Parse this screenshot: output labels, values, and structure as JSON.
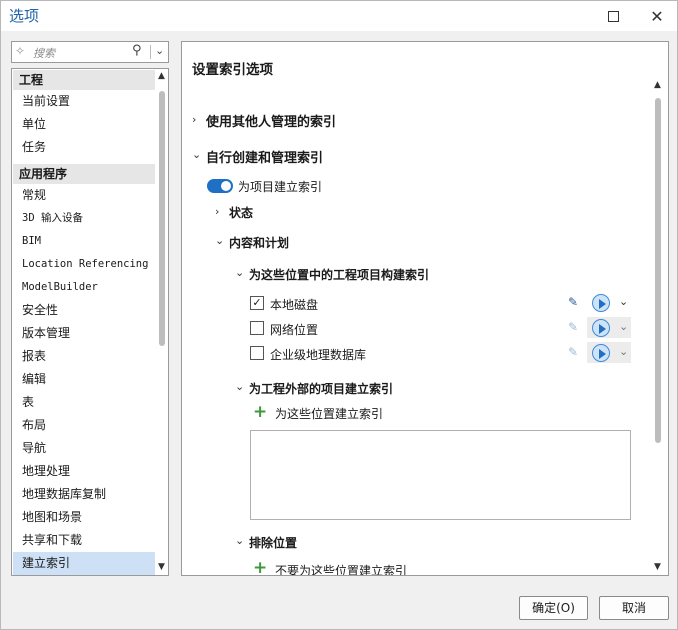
{
  "window": {
    "title": "选项"
  },
  "search": {
    "placeholder": "搜索"
  },
  "sidebar": {
    "groups": [
      {
        "label": "工程",
        "items": [
          "当前设置",
          "单位",
          "任务"
        ]
      },
      {
        "label": "应用程序",
        "items": [
          "常规",
          "3D 输入设备",
          "BIM",
          "Location Referencing",
          "ModelBuilder",
          "安全性",
          "版本管理",
          "报表",
          "编辑",
          "表",
          "布局",
          "导航",
          "地理处理",
          "地理数据库复制",
          "地图和场景",
          "共享和下载",
          "建立索引"
        ]
      }
    ],
    "selected": "建立索引"
  },
  "main": {
    "title": "设置索引选项",
    "sections": {
      "managed_by_others": "使用其他人管理的索引",
      "self_managed": "自行创建和管理索引",
      "toggle_label": "为项目建立索引",
      "status": "状态",
      "content_plan": "内容和计划",
      "project_locations": "为这些位置中的工程项目构建索引",
      "locations": [
        {
          "label": "本地磁盘",
          "checked": true
        },
        {
          "label": "网络位置",
          "checked": false
        },
        {
          "label": "企业级地理数据库",
          "checked": false
        }
      ],
      "external_items": "为工程外部的项目建立索引",
      "add_locations": "为这些位置建立索引",
      "exclude": "排除位置",
      "exclude_add": "不要为这些位置建立索引"
    },
    "toggle_on": true
  },
  "buttons": {
    "ok": "确定(O)",
    "cancel": "取消"
  },
  "colors": {
    "accent": "#1f6fc5",
    "title": "#1f64a8",
    "selection": "#cde0f5"
  }
}
